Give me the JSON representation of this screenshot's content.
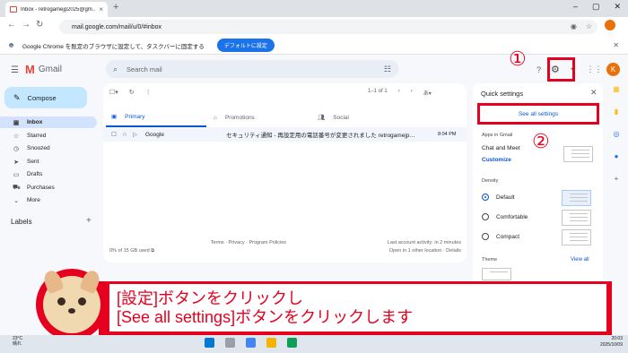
{
  "browser": {
    "tab_title": "Inbox - retrogamejp2025@gm…",
    "url": "mail.google.com/mail/u/0/#inbox",
    "infobar_message": "Google Chrome を既定のブラウザに設定して、タスクバーに固定する",
    "infobar_button": "デフォルトに設定"
  },
  "gmail": {
    "logo_text": "Gmail",
    "search_placeholder": "Search mail",
    "avatar_letter": "K",
    "compose_label": "Compose",
    "nav": [
      "Inbox",
      "Starred",
      "Snoozed",
      "Sent",
      "Drafts",
      "Purchases",
      "More"
    ],
    "labels_heading": "Labels",
    "pager_text": "1–1 of 1",
    "tabs": [
      "Primary",
      "Promotions",
      "Social"
    ],
    "email": {
      "sender": "Google",
      "subject": "セキュリティ通知 - 再設定用の電話番号が変更されました retrogamejp…",
      "time": "8:04 PM"
    },
    "storage_text": "0% of 15 GB used",
    "footer_links": "Terms · Privacy · Program Policies",
    "activity_line1": "Last account activity: in 2 minutes",
    "activity_line2": "Open in 1 other location · Details"
  },
  "quick_settings": {
    "title": "Quick settings",
    "see_all": "See all settings",
    "apps_heading": "Apps in Gmail",
    "apps_text": "Chat and Meet",
    "customize": "Customize",
    "density_heading": "Density",
    "density_options": [
      "Default",
      "Comfortable",
      "Compact"
    ],
    "theme_heading": "Theme",
    "view_all": "View all"
  },
  "annotations": {
    "marker1": "①",
    "marker2": "②",
    "line1": "[設定]ボタンをクリックし",
    "line2": "[See all settings]ボタンをクリックします"
  },
  "taskbar": {
    "temp": "23°C",
    "weather": "晴れ",
    "time": "20:03",
    "date": "2025/10/09"
  },
  "colors": {
    "highlight_red": "#e6001f",
    "gmail_blue": "#0b57d0",
    "compose_bg": "#c2e7ff"
  }
}
